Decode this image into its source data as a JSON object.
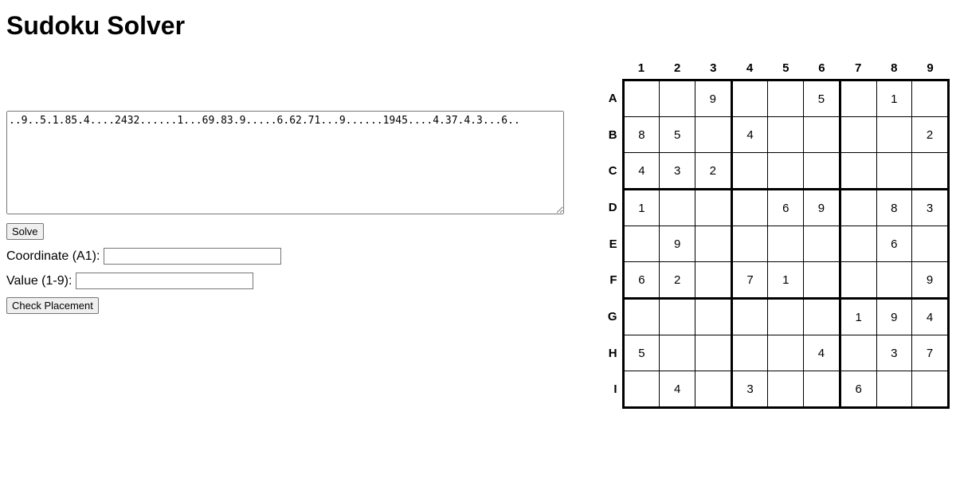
{
  "title": "Sudoku Solver",
  "puzzle_textarea": "..9..5.1.85.4....2432......1...69.83.9.....6.62.71...9......1945....4.37.4.3...6..",
  "solve_button": "Solve",
  "coordinate_label": "Coordinate (A1):",
  "coordinate_value": "",
  "value_label": "Value (1-9):",
  "value_value": "",
  "check_button": "Check Placement",
  "col_headers": [
    "1",
    "2",
    "3",
    "4",
    "5",
    "6",
    "7",
    "8",
    "9"
  ],
  "row_headers": [
    "A",
    "B",
    "C",
    "D",
    "E",
    "F",
    "G",
    "H",
    "I"
  ],
  "grid": [
    [
      "",
      "",
      "9",
      "",
      "",
      "5",
      "",
      "1",
      ""
    ],
    [
      "8",
      "5",
      "",
      "4",
      "",
      "",
      "",
      "",
      "2"
    ],
    [
      "4",
      "3",
      "2",
      "",
      "",
      "",
      "",
      "",
      ""
    ],
    [
      "1",
      "",
      "",
      "",
      "6",
      "9",
      "",
      "8",
      "3"
    ],
    [
      "",
      "9",
      "",
      "",
      "",
      "",
      "",
      "6",
      ""
    ],
    [
      "6",
      "2",
      "",
      "7",
      "1",
      "",
      "",
      "",
      "9"
    ],
    [
      "",
      "",
      "",
      "",
      "",
      "",
      "1",
      "9",
      "4"
    ],
    [
      "5",
      "",
      "",
      "",
      "",
      "4",
      "",
      "3",
      "7"
    ],
    [
      "",
      "4",
      "",
      "3",
      "",
      "",
      "6",
      "",
      ""
    ]
  ]
}
